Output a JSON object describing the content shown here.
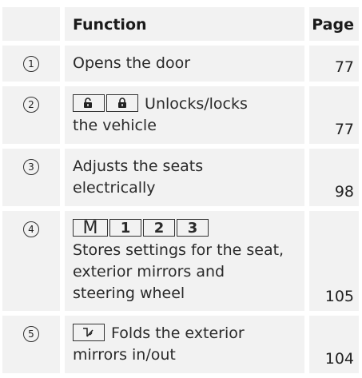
{
  "table": {
    "headers": {
      "function": "Function",
      "page": "Page"
    },
    "rows": [
      {
        "num": "1",
        "lines": [
          "Opens the door"
        ],
        "page": "77"
      },
      {
        "num": "2",
        "lines": [
          "Unlocks/locks",
          "the vehicle"
        ],
        "page": "77",
        "keys": [
          "unlock-icon",
          "lock-icon"
        ]
      },
      {
        "num": "3",
        "lines": [
          "Adjusts the seats",
          "electrically"
        ],
        "page": "98"
      },
      {
        "num": "4",
        "keys": [
          "M",
          "1",
          "2",
          "3"
        ],
        "lines": [
          "Stores settings for the seat,",
          "exterior mirrors and",
          "steering wheel"
        ],
        "page": "105"
      },
      {
        "num": "5",
        "lines": [
          "Folds the exterior",
          "mirrors in/out"
        ],
        "page": "104",
        "keys": [
          "mirror-fold-icon"
        ]
      }
    ]
  }
}
